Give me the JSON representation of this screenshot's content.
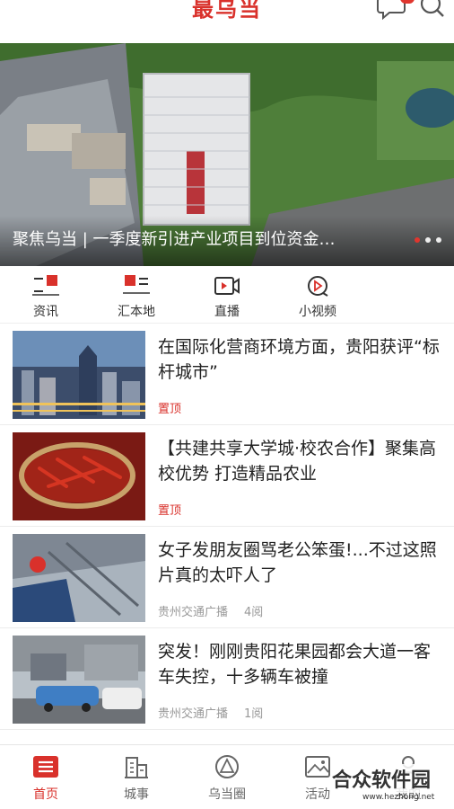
{
  "header": {
    "app_title": "最乌当"
  },
  "banner": {
    "title": "聚焦乌当 | 一季度新引进产业项目到位资金…",
    "dot_count": 3,
    "active_dot": 0
  },
  "categories": [
    {
      "label": "资讯",
      "icon": "news-icon"
    },
    {
      "label": "汇本地",
      "icon": "local-icon"
    },
    {
      "label": "直播",
      "icon": "live-icon"
    },
    {
      "label": "小视频",
      "icon": "short-video-icon"
    }
  ],
  "news": [
    {
      "headline": "在国际化营商环境方面，贵阳获评“标杆城市”",
      "tag": "置顶",
      "source": "",
      "views": ""
    },
    {
      "headline": "【共建共享大学城·校农合作】聚集高校优势 打造精品农业",
      "tag": "置顶",
      "source": "",
      "views": ""
    },
    {
      "headline": "女子发朋友圈骂老公笨蛋!...不过这照片真的太吓人了",
      "tag": "",
      "source": "贵州交通广播",
      "views": "4阅"
    },
    {
      "headline": "突发！刚刚贵阳花果园都会大道一客车失控，十多辆车被撞",
      "tag": "",
      "source": "贵州交通广播",
      "views": "1阅"
    }
  ],
  "bottom_nav": [
    {
      "label": "首页",
      "icon": "home-icon",
      "active": true
    },
    {
      "label": "城事",
      "icon": "city-icon",
      "active": false
    },
    {
      "label": "乌当圈",
      "icon": "circle-icon",
      "active": false
    },
    {
      "label": "活动",
      "icon": "activity-icon",
      "active": false
    },
    {
      "label": "我的",
      "icon": "profile-icon",
      "active": false
    }
  ],
  "watermark": {
    "text": "合众软件园",
    "url": "www.hezhong.net"
  },
  "colors": {
    "accent": "#d9312b"
  }
}
